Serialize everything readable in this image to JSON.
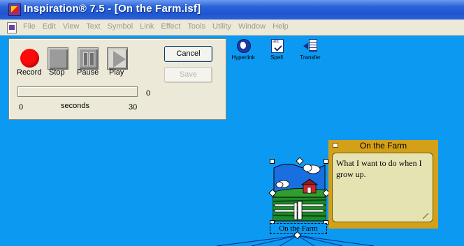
{
  "window": {
    "title": "Inspiration® 7.5 - [On the Farm.isf]"
  },
  "menu": [
    "File",
    "Edit",
    "View",
    "Text",
    "Symbol",
    "Link",
    "Effect",
    "Tools",
    "Utility",
    "Window",
    "Help"
  ],
  "toolbar": [
    {
      "label": "Hyperlink",
      "icon": "hyperlink-icon"
    },
    {
      "label": "Spell",
      "icon": "spell-icon"
    },
    {
      "label": "Transfer",
      "icon": "transfer-icon"
    }
  ],
  "recorder": {
    "buttons": [
      "Record",
      "Stop",
      "Pause",
      "Play"
    ],
    "cancel_label": "Cancel",
    "save_label": "Save",
    "elapsed": "0",
    "scale_start": "0",
    "scale_unit": "seconds",
    "scale_end": "30",
    "progress_fraction": 0
  },
  "note": {
    "title": "On the Farm",
    "text": "What I want to do when I grow up."
  },
  "symbol": {
    "label": "On the Farm"
  },
  "colors": {
    "canvas": "#0b99f2",
    "note": "#d4a017",
    "record": "#ff0a0a"
  }
}
